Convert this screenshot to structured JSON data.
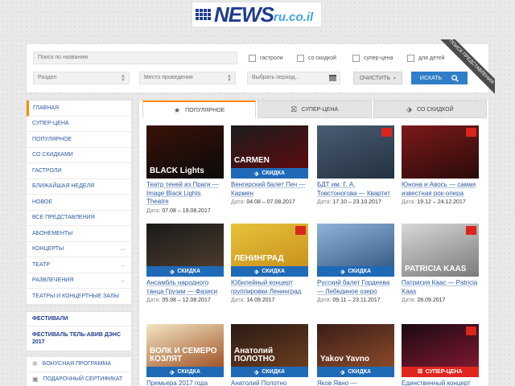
{
  "logo": {
    "news": "NEWS",
    "domain": "ru.co.il"
  },
  "search": {
    "name_placeholder": "Поиск по названию",
    "section_placeholder": "Раздел",
    "venue_placeholder": "Место проведения",
    "period_placeholder": "Выбрать период...",
    "checkboxes": [
      "гастроли",
      "со скидкой",
      "супер-цена",
      "для детей"
    ],
    "clear_label": "ОЧИСТИТЬ",
    "search_label": "ИСКАТЬ",
    "ribbon": "ПОИСК ПРЕДСТАВЛЕНИЯ"
  },
  "sidebar": {
    "items": [
      {
        "label": "ГЛАВНАЯ",
        "arrow": ""
      },
      {
        "label": "СУПЕР-ЦЕНА",
        "arrow": ""
      },
      {
        "label": "ПОПУЛЯРНОЕ",
        "arrow": ""
      },
      {
        "label": "СО СКИДКАМИ",
        "arrow": ""
      },
      {
        "label": "ГАСТРОЛИ",
        "arrow": ""
      },
      {
        "label": "БЛИЖАЙШАЯ НЕДЕЛЯ",
        "arrow": ""
      },
      {
        "label": "НОВОЕ",
        "arrow": ""
      },
      {
        "label": "ВСЕ ПРЕДСТАВЛЕНИЯ",
        "arrow": ""
      },
      {
        "label": "АБОНЕМЕНТЫ",
        "arrow": ""
      },
      {
        "label": "КОНЦЕРТЫ",
        "arrow": "→"
      },
      {
        "label": "ТЕАТР",
        "arrow": "→"
      },
      {
        "label": "РАЗВЛЕЧЕНИЯ",
        "arrow": "→"
      },
      {
        "label": "ТЕАТРЫ И КОНЦЕРТНЫЕ ЗАЛЫ",
        "arrow": ""
      }
    ],
    "fest_heading": "ФЕСТИВАЛИ",
    "fest_item": "ФЕСТИВАЛЬ ТЕЛЬ-АВИВ ДЭНС 2017",
    "extra": [
      {
        "label": "БОНУСНАЯ ПРОГРАММА",
        "icon": "gear-icon"
      },
      {
        "label": "ПОДАРОЧНЫЙ СЕРТИФИКАТ",
        "icon": "gift-icon"
      }
    ]
  },
  "tabs": [
    {
      "label": "ПОПУЛЯРНОЕ",
      "icon": "star-icon"
    },
    {
      "label": "СУПЕР-ЦЕНА",
      "icon": "gift-icon"
    },
    {
      "label": "СО СКИДКОЙ",
      "icon": "tag-icon"
    }
  ],
  "date_prefix": "Дата:",
  "cards": [
    {
      "title": "Театр теней из Праги — Image Black Lights Theatre",
      "date": "07.08 – 19.08.2017",
      "badge": "",
      "poster_text": "BLACK Lights",
      "colors": [
        "#3a1208",
        "#0a0a0a"
      ]
    },
    {
      "title": "Венгерский балет Печ — Кармен",
      "date": "04.08 – 07.08.2017",
      "badge": "СКИДКА",
      "poster_text": "CARMEN",
      "colors": [
        "#1c1c1c",
        "#5c0c10"
      ]
    },
    {
      "title": "БДТ им. Г. А. Товстоногова — Квартет",
      "date": "17.10 – 23.10.2017",
      "badge": "",
      "poster_text": "",
      "colors": [
        "#4a5d74",
        "#23313f"
      ]
    },
    {
      "title": "Юнона и Авось — самая известная рок-опера",
      "date": "19.12 – 24.12.2017",
      "badge": "",
      "poster_text": "",
      "colors": [
        "#7c1a1a",
        "#2a0a0a"
      ]
    },
    {
      "title": "Ансамбль народного танца Грузии — Фазиси",
      "date": "05.08 – 12.08.2017",
      "badge": "СКИДКА",
      "poster_text": "",
      "colors": [
        "#1a1a1a",
        "#4b3b2b"
      ]
    },
    {
      "title": "Юбилейный концерт группировки Ленинград",
      "date": "14.09.2017",
      "badge": "СКИДКА",
      "poster_text": "ЛЕНИНГРАД",
      "colors": [
        "#e7c23b",
        "#c9931c"
      ]
    },
    {
      "title": "Русский балет Гордеева — Лебединое озеро",
      "date": "09.11 – 23.11.2017",
      "badge": "СКИДКА",
      "poster_text": "",
      "colors": [
        "#8fb4d8",
        "#3b5e88"
      ]
    },
    {
      "title": "Патрисия Каас — Patricia Kaas",
      "date": "28.09.2017",
      "badge": "",
      "poster_text": "PATRICIA KAAS",
      "colors": [
        "#d8d8d8",
        "#7a7a7a"
      ]
    },
    {
      "title": "Премьера 2017 года",
      "date": "",
      "badge": "СКИДКА",
      "poster_text": "ВОЛК И СЕМЕРО КОЗЛЯТ",
      "colors": [
        "#f1e6c2",
        "#a3552a"
      ]
    },
    {
      "title": "Анатолий Полотно",
      "date": "",
      "badge": "СКИДКА",
      "poster_text": "Анатолий ПОЛОТНО",
      "colors": [
        "#2a1a14",
        "#6b3d1f"
      ]
    },
    {
      "title": "Яков Явно —",
      "date": "",
      "badge": "СКИДКА",
      "poster_text": "Yakov Yavno",
      "colors": [
        "#3b1d18",
        "#8a4a2a"
      ]
    },
    {
      "title": "Единственный концерт",
      "date": "",
      "badge": "СУПЕР-ЦЕНА",
      "poster_text": "",
      "colors": [
        "#1a0a12",
        "#7d1830"
      ]
    }
  ],
  "colors": {
    "accent": "#ff8a00",
    "link": "#2d5aa0",
    "badge_blue": "#1f6ab7",
    "badge_red": "#e0261e",
    "search_btn": "#2f7ec8"
  }
}
